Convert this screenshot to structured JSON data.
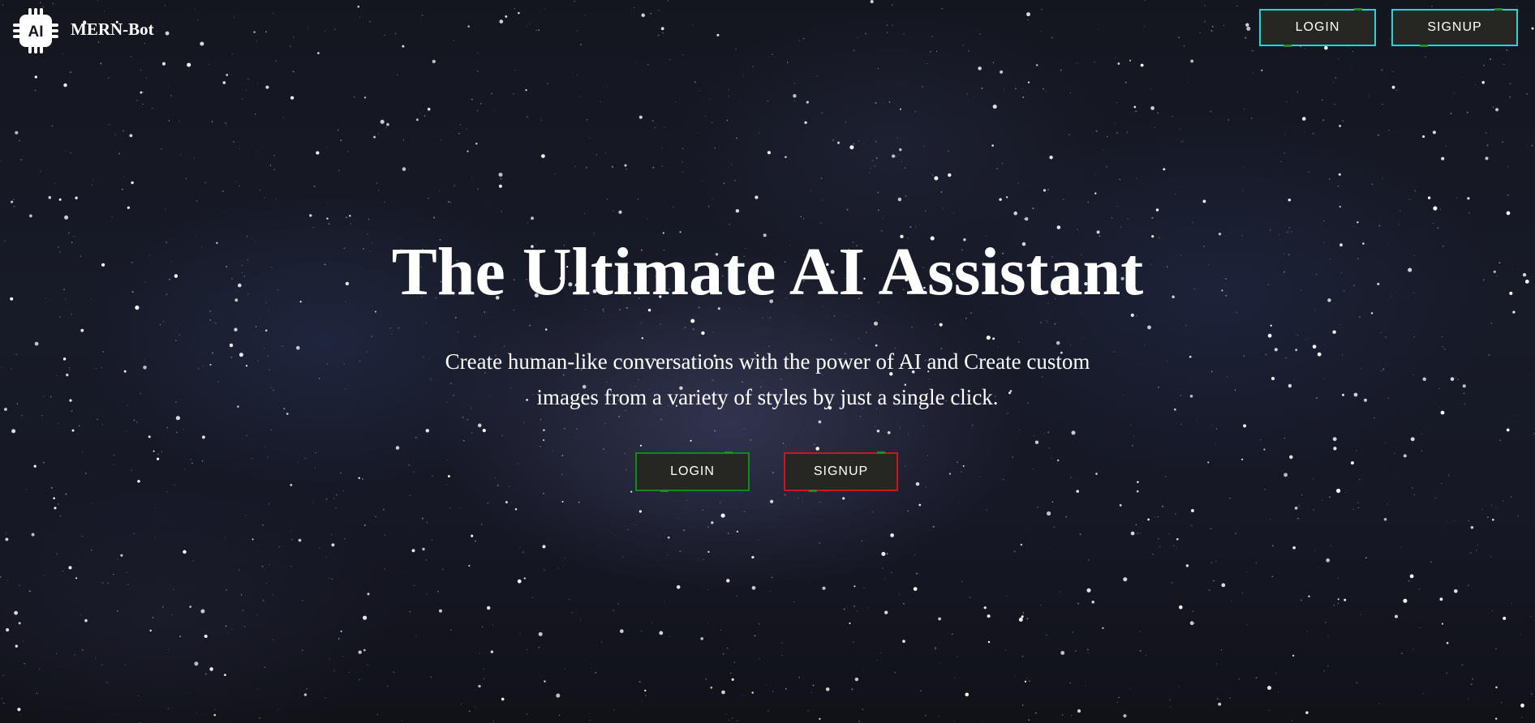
{
  "brand": {
    "name": "MERN-Bot",
    "logo_icon": "ai-chip-icon",
    "logo_text": "AI"
  },
  "nav": {
    "login_label": "LOGIN",
    "signup_label": "SIGNUP"
  },
  "hero": {
    "title": "The Ultimate AI Assistant",
    "description": "Create human-like conversations with the power of AI and Create custom images from a variety of styles by just a single click.",
    "login_label": "LOGIN",
    "signup_label": "SIGNUP"
  },
  "colors": {
    "nav_button_border": "#2ad3d8",
    "login_border": "#0f8a1e",
    "signup_border": "#d0141b",
    "button_fill": "#262622",
    "accent_tick": "#1f8a2c"
  }
}
